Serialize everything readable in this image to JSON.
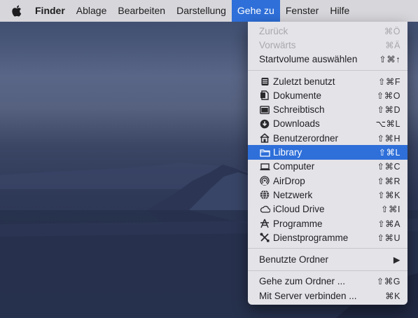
{
  "menubar": {
    "items": [
      {
        "label": "Finder"
      },
      {
        "label": "Ablage"
      },
      {
        "label": "Bearbeiten"
      },
      {
        "label": "Darstellung"
      },
      {
        "label": "Gehe zu"
      },
      {
        "label": "Fenster"
      },
      {
        "label": "Hilfe"
      }
    ]
  },
  "menu": {
    "section1": [
      {
        "label": "Zurück",
        "shortcut": "⌘Ö",
        "enabled": false
      },
      {
        "label": "Vorwärts",
        "shortcut": "⌘Ä",
        "enabled": false
      },
      {
        "label": "Startvolume auswählen",
        "shortcut": "⇧⌘↑",
        "enabled": true
      }
    ],
    "section2": [
      {
        "label": "Zuletzt benutzt",
        "shortcut": "⇧⌘F",
        "icon": "recents-icon"
      },
      {
        "label": "Dokumente",
        "shortcut": "⇧⌘O",
        "icon": "documents-icon"
      },
      {
        "label": "Schreibtisch",
        "shortcut": "⇧⌘D",
        "icon": "desktop-icon"
      },
      {
        "label": "Downloads",
        "shortcut": "⌥⌘L",
        "icon": "downloads-icon"
      },
      {
        "label": "Benutzerordner",
        "shortcut": "⇧⌘H",
        "icon": "home-icon"
      },
      {
        "label": "Library",
        "shortcut": "⇧⌘L",
        "icon": "folder-icon",
        "selected": true
      },
      {
        "label": "Computer",
        "shortcut": "⇧⌘C",
        "icon": "computer-icon"
      },
      {
        "label": "AirDrop",
        "shortcut": "⇧⌘R",
        "icon": "airdrop-icon"
      },
      {
        "label": "Netzwerk",
        "shortcut": "⇧⌘K",
        "icon": "network-icon"
      },
      {
        "label": "iCloud Drive",
        "shortcut": "⇧⌘I",
        "icon": "icloud-icon"
      },
      {
        "label": "Programme",
        "shortcut": "⇧⌘A",
        "icon": "applications-icon"
      },
      {
        "label": "Dienstprogramme",
        "shortcut": "⇧⌘U",
        "icon": "utilities-icon"
      }
    ],
    "section3": [
      {
        "label": "Benutzte Ordner",
        "submenu_arrow": "▶"
      }
    ],
    "section4": [
      {
        "label": "Gehe zum Ordner ...",
        "shortcut": "⇧⌘G"
      },
      {
        "label": "Mit Server verbinden ...",
        "shortcut": "⌘K"
      }
    ]
  },
  "colors": {
    "accent": "#2e6fd9",
    "menubar_bg": "#d7d6da",
    "menu_bg": "#e4e3e8"
  }
}
